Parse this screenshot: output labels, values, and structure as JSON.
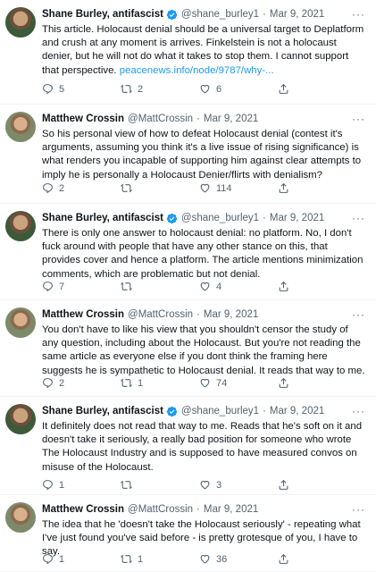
{
  "tweets": [
    {
      "name": "Shane Burley, antifascist",
      "verified": true,
      "handle": "@shane_burley1",
      "date": "Mar 9, 2021",
      "text": "This article. Holocaust denial should be a universal target to Deplatform and crush at any moment is arrives. Finkelstein is not a holocaust denier, but he will not do what it takes to stop them. I cannot support that perspective. ",
      "link": "peacenews.info/node/9787/why-...",
      "replies": "5",
      "retweets": "2",
      "likes": "6"
    },
    {
      "name": "Matthew Crossin",
      "verified": false,
      "handle": "@MattCrossin",
      "date": "Mar 9, 2021",
      "text": "So his personal view of how to defeat Holocaust denial (contest it's arguments, assuming you think it's a live issue of rising significance) is what renders you incapable of supporting him against clear attempts to imply he is personally a Holocaust Denier/flirts with denialism?",
      "replies": "2",
      "retweets": "",
      "likes": "114"
    },
    {
      "name": "Shane Burley, antifascist",
      "verified": true,
      "handle": "@shane_burley1",
      "date": "Mar 9, 2021",
      "text": "There is only one answer to holocaust denial: no platform. No, I don't fuck around with people that have any other stance on this, that provides cover and hence a platform. The article mentions minimization comments, which are problematic but not denial.",
      "replies": "7",
      "retweets": "",
      "likes": "4"
    },
    {
      "name": "Matthew Crossin",
      "verified": false,
      "handle": "@MattCrossin",
      "date": "Mar 9, 2021",
      "text": "You don't have to like his view that you shouldn't censor the study of any question, including about the Holocaust. But you're not reading the same article as everyone else if you dont think the framing here suggests he is sympathetic to Holocaust denial. It reads that way to me.",
      "replies": "2",
      "retweets": "1",
      "likes": "74"
    },
    {
      "name": "Shane Burley, antifascist",
      "verified": true,
      "handle": "@shane_burley1",
      "date": "Mar 9, 2021",
      "text": "It definitely does not read that way to me. Reads that he's soft on it and doesn't take it seriously, a really bad position for someone who wrote The Holocaust Industry and is supposed to have measured convos on misuse of the Holocaust.",
      "replies": "1",
      "retweets": "",
      "likes": "3"
    },
    {
      "name": "Matthew Crossin",
      "verified": false,
      "handle": "@MattCrossin",
      "date": "Mar 9, 2021",
      "text": "The idea that he 'doesn't take the Holocaust seriously' - repeating what I've just found you've said before - is pretty grotesque of you, I have to say.",
      "replies": "1",
      "retweets": "1",
      "likes": "36"
    }
  ],
  "separator": "·",
  "more_glyph": "···",
  "accent": "#1d9bf0"
}
